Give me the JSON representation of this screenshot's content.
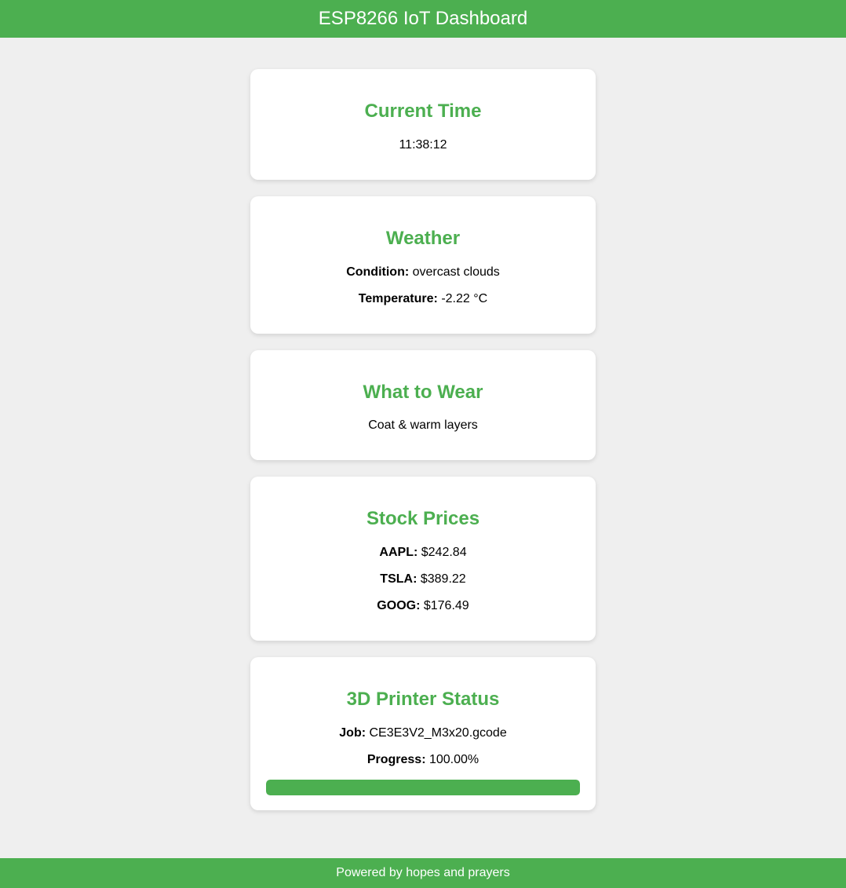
{
  "header": {
    "title": "ESP8266 IoT Dashboard"
  },
  "time_card": {
    "title": "Current Time",
    "value": "11:38:12"
  },
  "weather_card": {
    "title": "Weather",
    "condition_label": "Condition:",
    "condition_value": "overcast clouds",
    "temperature_label": "Temperature:",
    "temperature_value": "-2.22 °C"
  },
  "wear_card": {
    "title": "What to Wear",
    "value": "Coat & warm layers"
  },
  "stocks_card": {
    "title": "Stock Prices",
    "items": [
      {
        "symbol": "AAPL:",
        "price": "$242.84"
      },
      {
        "symbol": "TSLA:",
        "price": "$389.22"
      },
      {
        "symbol": "GOOG:",
        "price": "$176.49"
      }
    ]
  },
  "printer_card": {
    "title": "3D Printer Status",
    "job_label": "Job:",
    "job_value": "CE3E3V2_M3x20.gcode",
    "progress_label": "Progress:",
    "progress_value": "100.00%",
    "progress_fraction": 1.0
  },
  "footer": {
    "text": "Powered by hopes and prayers"
  },
  "colors": {
    "accent": "#4caf50",
    "background": "#efefef",
    "card": "#ffffff"
  }
}
